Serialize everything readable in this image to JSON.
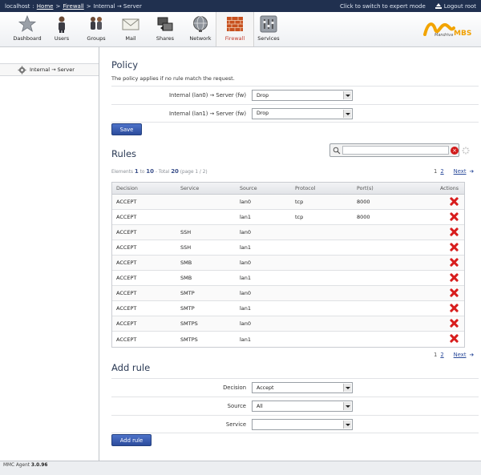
{
  "topbar": {
    "host": "localhost",
    "sep": ":",
    "breadcrumb": [
      {
        "label": "Home"
      },
      {
        "label": "Firewall"
      }
    ],
    "crumb_sep": ">",
    "current": "Internal → Server",
    "expert_mode": "Click to switch to expert mode",
    "logout": "Logout root"
  },
  "nav": [
    {
      "label": "Dashboard",
      "icon": "star-icon"
    },
    {
      "label": "Users",
      "icon": "user-icon"
    },
    {
      "label": "Groups",
      "icon": "group-icon"
    },
    {
      "label": "Mail",
      "icon": "mail-icon"
    },
    {
      "label": "Shares",
      "icon": "shares-icon"
    },
    {
      "label": "Network",
      "icon": "globe-icon"
    },
    {
      "label": "Firewall",
      "icon": "firewall-icon",
      "active": true
    },
    {
      "label": "Services",
      "icon": "services-icon"
    }
  ],
  "logo": {
    "brand": "Mandriva",
    "product": "MBS"
  },
  "sidebar": {
    "submenu": "Internal → Server"
  },
  "policy": {
    "title": "Policy",
    "description": "The policy applies if no rule match the request.",
    "rows": [
      {
        "label": "Internal (lan0) → Server (fw)",
        "value": "Drop"
      },
      {
        "label": "Internal (lan1) → Server (fw)",
        "value": "Drop"
      }
    ],
    "save_label": "Save"
  },
  "rules": {
    "title": "Rules",
    "search": {
      "value": "",
      "placeholder": ""
    },
    "meta": {
      "elements": "Elements",
      "from": "1",
      "to_word": "to",
      "to": "10",
      "total_word": "- Total",
      "total": "20",
      "page": "(page 1 / 2)"
    },
    "pager": {
      "current": "1",
      "page2": "2",
      "next": "Next"
    },
    "columns": [
      "Decision",
      "Service",
      "Source",
      "Protocol",
      "Port(s)",
      "Actions"
    ],
    "rows": [
      {
        "decision": "ACCEPT",
        "service": "",
        "source": "lan0",
        "protocol": "tcp",
        "ports": "8000"
      },
      {
        "decision": "ACCEPT",
        "service": "",
        "source": "lan1",
        "protocol": "tcp",
        "ports": "8000"
      },
      {
        "decision": "ACCEPT",
        "service": "SSH",
        "source": "lan0",
        "protocol": "",
        "ports": ""
      },
      {
        "decision": "ACCEPT",
        "service": "SSH",
        "source": "lan1",
        "protocol": "",
        "ports": ""
      },
      {
        "decision": "ACCEPT",
        "service": "SMB",
        "source": "lan0",
        "protocol": "",
        "ports": ""
      },
      {
        "decision": "ACCEPT",
        "service": "SMB",
        "source": "lan1",
        "protocol": "",
        "ports": ""
      },
      {
        "decision": "ACCEPT",
        "service": "SMTP",
        "source": "lan0",
        "protocol": "",
        "ports": ""
      },
      {
        "decision": "ACCEPT",
        "service": "SMTP",
        "source": "lan1",
        "protocol": "",
        "ports": ""
      },
      {
        "decision": "ACCEPT",
        "service": "SMTPS",
        "source": "lan0",
        "protocol": "",
        "ports": ""
      },
      {
        "decision": "ACCEPT",
        "service": "SMTPS",
        "source": "lan1",
        "protocol": "",
        "ports": ""
      }
    ]
  },
  "add_rule": {
    "title": "Add rule",
    "fields": [
      {
        "label": "Decision",
        "value": "Accept"
      },
      {
        "label": "Source",
        "value": "All"
      },
      {
        "label": "Service",
        "value": ""
      }
    ],
    "button_label": "Add rule"
  },
  "footer": {
    "agent": "MMC Agent",
    "version": "3.0.96"
  },
  "colors": {
    "topbar": "#20304f",
    "button": "#2c4c9c",
    "delete": "#d81d1d",
    "active_tab_label": "#c0392b"
  }
}
